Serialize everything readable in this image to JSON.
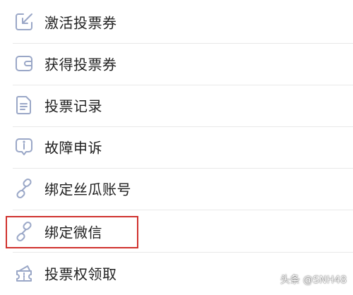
{
  "menu": {
    "items": [
      {
        "label": "激活投票券",
        "icon": "activate-arrow-icon"
      },
      {
        "label": "获得投票券",
        "icon": "wallet-icon"
      },
      {
        "label": "投票记录",
        "icon": "document-icon"
      },
      {
        "label": "故障申诉",
        "icon": "info-bubble-icon"
      },
      {
        "label": "绑定丝瓜账号",
        "icon": "link-icon"
      },
      {
        "label": "绑定微信",
        "icon": "link-icon"
      },
      {
        "label": "投票权领取",
        "icon": "ticket-icon"
      }
    ]
  },
  "highlight": {
    "item": "绑定微信",
    "color": "#d0312d"
  },
  "watermark": {
    "text": "头条 @SNH48"
  },
  "colors": {
    "icon": "#9aa7c7",
    "text": "#1f1f1f",
    "divider": "#e8e8e8"
  }
}
